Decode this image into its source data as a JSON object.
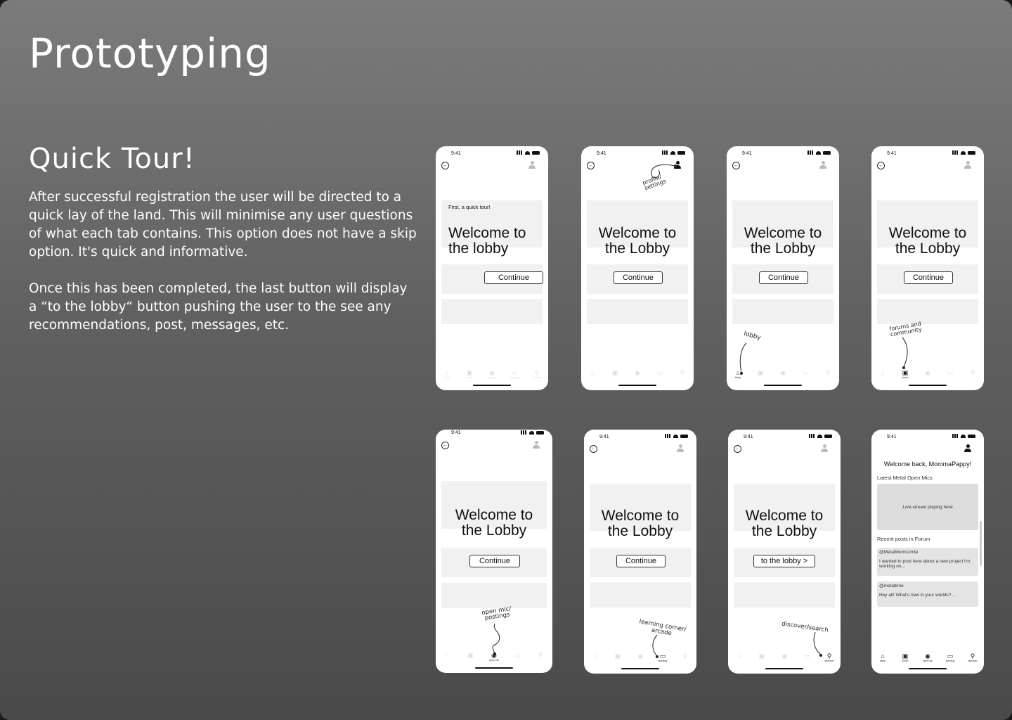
{
  "page": {
    "title": "Prototyping",
    "subtitle": "Quick Tour!",
    "paragraphs": [
      "After successful registration the user will be directed to a quick lay of the land. This will minimise any user questions of what each tab contains. This option does not have a skip option. It's quick and informative.",
      "Once this has been completed, the last button will display a “to the lobby“ button pushing the user to the see any recommendations, post, messages, etc."
    ]
  },
  "phone": {
    "time": "9:41",
    "welcome": "Welcome to the Lobby",
    "welcome_first": "Welcome to the lobby",
    "first_tour": "First, a quick tour!",
    "continue": "Continue",
    "to_lobby": "to the lobby >",
    "nav": [
      "lobby",
      "forum",
      "open mic",
      "learning",
      "discover"
    ]
  },
  "annotations": {
    "profile": "profile/ settings",
    "lobby": "lobby",
    "forums": "forums and community",
    "open_mic": "open mic/ postings",
    "learning": "learning corner/ arcade",
    "discover": "discover/search"
  },
  "home_screen": {
    "greeting": "Welcome back, MommaPappy!",
    "latest_label": "Latest Metal Open Mics",
    "stream_text": "Live-stream playing here",
    "recent_label": "Recent posts in Forum",
    "posts": [
      {
        "user": "@MetalMomsUnite",
        "text": "I wanted to post here about a new project I'm working on..."
      },
      {
        "user": "@metaltime",
        "text": "Hey all! What's new in your worlds?..."
      }
    ]
  }
}
